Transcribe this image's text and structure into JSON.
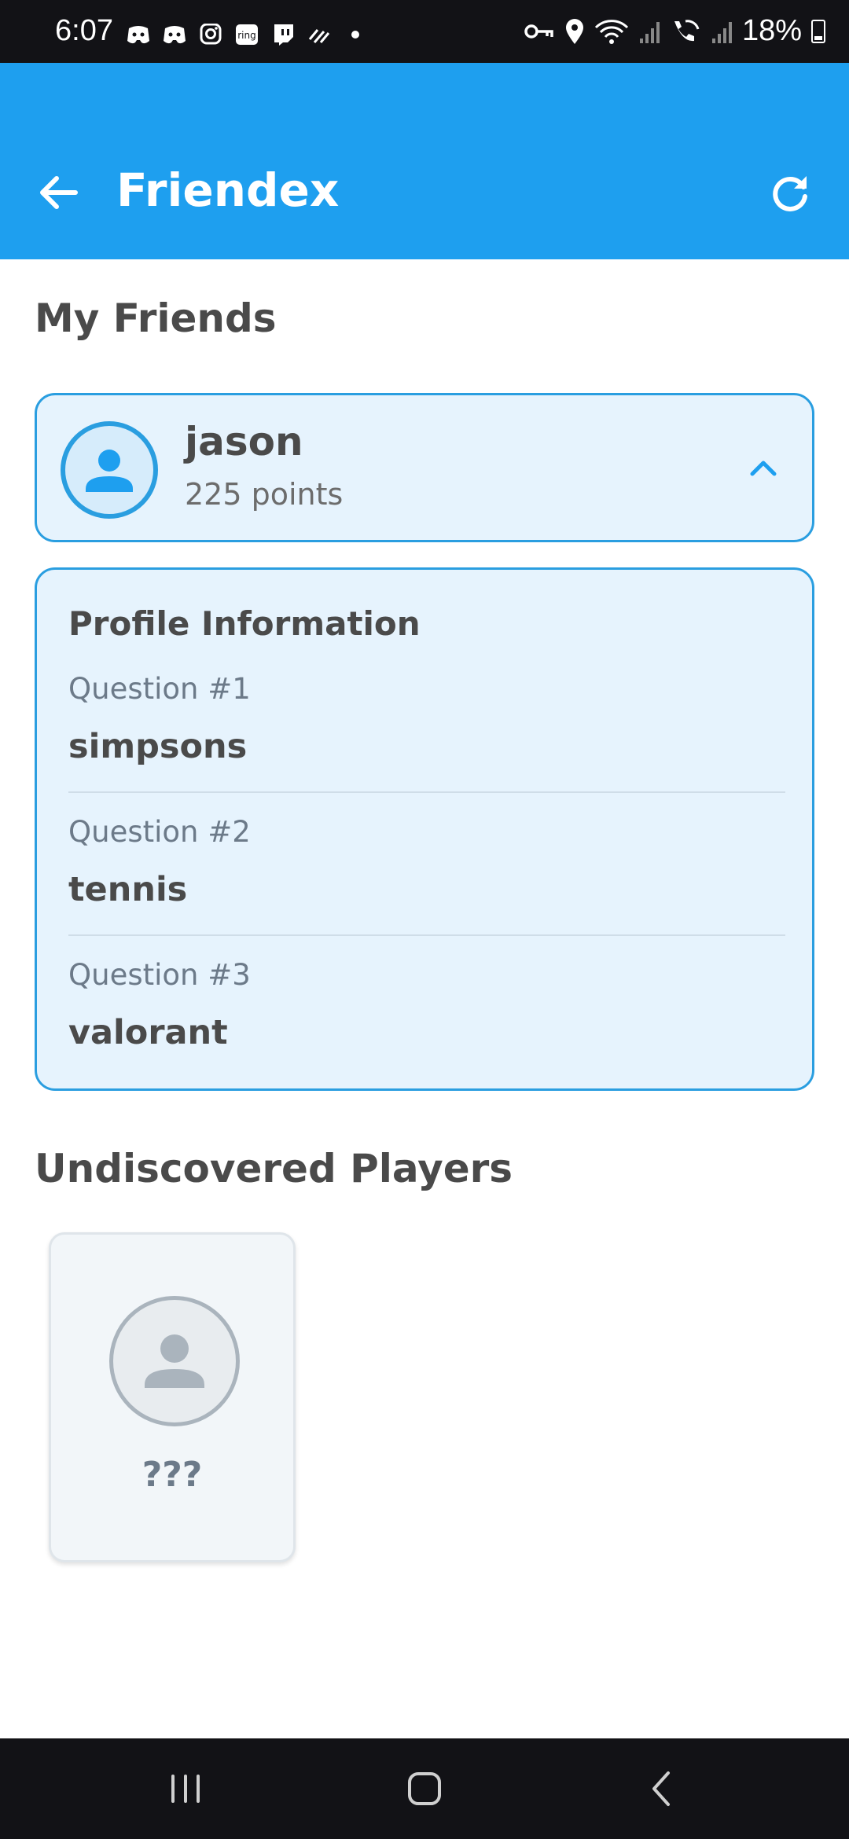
{
  "status_bar": {
    "time": "6:07",
    "battery": "18%",
    "left_icons": [
      "discord-icon",
      "discord-icon",
      "instagram-icon",
      "ring-icon",
      "twitch-icon",
      "activity-icon",
      "dot-icon"
    ],
    "right_icons": [
      "vpn-key-icon",
      "location-icon",
      "wifi-icon",
      "signal-icon",
      "wifi-call-icon",
      "signal-icon",
      "battery-icon"
    ]
  },
  "app_bar": {
    "title": "Friendex",
    "background": "#1e9fef"
  },
  "my_friends": {
    "title": "My Friends",
    "friends": [
      {
        "name": "jason",
        "points": "225 points",
        "expanded": true
      }
    ]
  },
  "profile": {
    "heading": "Profile Information",
    "questions": [
      {
        "label": "Question #1",
        "answer": "simpsons"
      },
      {
        "label": "Question #2",
        "answer": "tennis"
      },
      {
        "label": "Question #3",
        "answer": "valorant"
      }
    ]
  },
  "undiscovered": {
    "title": "Undiscovered Players",
    "players": [
      {
        "name": "???"
      }
    ]
  },
  "colors": {
    "accent": "#1e9fef",
    "card_border": "#2a9ee0",
    "card_bg": "#e6f3fd",
    "text": "#4a4a4a"
  }
}
